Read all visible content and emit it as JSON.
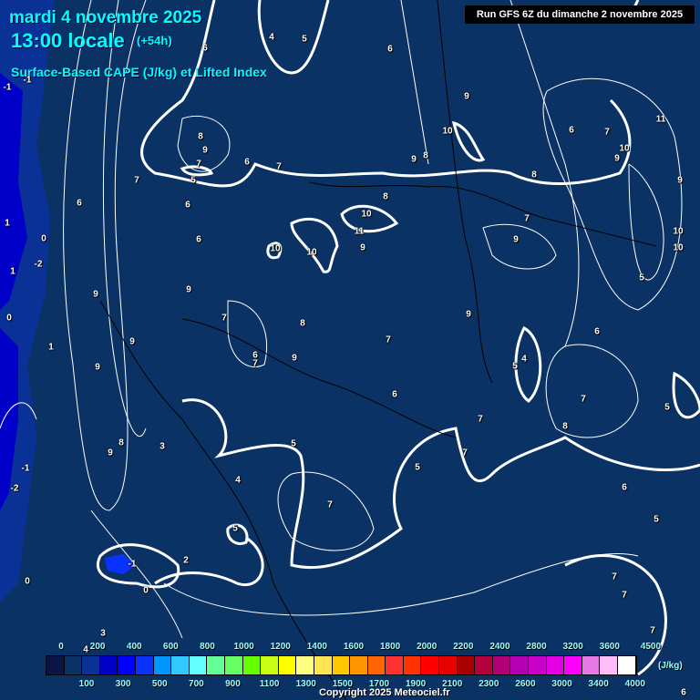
{
  "header": {
    "date": "mardi 4 novembre 2025",
    "time": "13:00 locale",
    "forecast_hour": "(+54h)",
    "subtitle": "Surface-Based CAPE (J/kg) et Lifted Index",
    "run": "Run GFS 6Z du dimanche 2 novembre 2025"
  },
  "map": {
    "labels": [
      "-1",
      "-1",
      "6",
      "4",
      "5",
      "6",
      "9",
      "8",
      "9",
      "7",
      "5",
      "6",
      "7",
      "7",
      "6",
      "6",
      "6",
      "1",
      "0",
      "-2",
      "1",
      "9",
      "9",
      "10",
      "11",
      "9",
      "10",
      "10",
      "8",
      "10",
      "9",
      "8",
      "8",
      "6",
      "7",
      "11",
      "10",
      "9",
      "9",
      "7",
      "9",
      "10",
      "10",
      "5",
      "9",
      "7",
      "8",
      "0",
      "1",
      "9",
      "6",
      "7",
      "9",
      "7",
      "6",
      "4",
      "5",
      "6",
      "7",
      "5",
      "8",
      "7",
      "7",
      "9",
      "8",
      "9",
      "3",
      "5",
      "5",
      "4",
      "7",
      "-1",
      "-2",
      "6",
      "5",
      "5",
      "-1",
      "2",
      "0",
      "0",
      "7",
      "7",
      "7",
      "3",
      "4",
      "6"
    ]
  },
  "legend": {
    "unit": "(J/kg)",
    "top_labels": [
      "0",
      "200",
      "400",
      "600",
      "800",
      "1000",
      "1200",
      "1400",
      "1600",
      "1800",
      "2000",
      "2200",
      "2400",
      "2800",
      "3200",
      "3600",
      "4500"
    ],
    "bottom_labels": [
      "100",
      "300",
      "500",
      "700",
      "900",
      "1100",
      "1300",
      "1500",
      "1700",
      "1900",
      "2100",
      "2300",
      "2600",
      "3000",
      "3400",
      "4000"
    ],
    "colors": [
      "#0a1446",
      "#0a3264",
      "#0a3296",
      "#0000c8",
      "#0000ff",
      "#0a32ff",
      "#0096ff",
      "#32c8ff",
      "#64ffff",
      "#64ff96",
      "#64ff64",
      "#64ff00",
      "#c8ff14",
      "#ffff00",
      "#ffff80",
      "#ffe650",
      "#ffc800",
      "#ff9600",
      "#ff6400",
      "#ff3232",
      "#ff3200",
      "#ff0000",
      "#e60000",
      "#aa0000",
      "#b4003c",
      "#b40078",
      "#b400b4",
      "#c800c8",
      "#e600e6",
      "#ff00ff",
      "#e678e6",
      "#ffbef7",
      "#ffffff"
    ]
  },
  "copyright": "Copyright 2025 Meteociel.fr"
}
